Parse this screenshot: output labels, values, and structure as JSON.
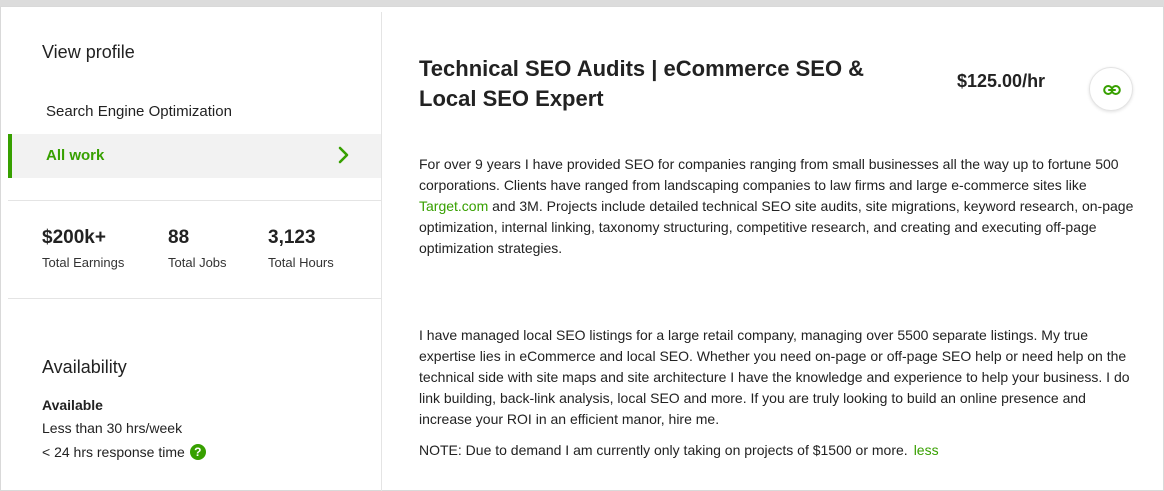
{
  "sidebar": {
    "view_profile": "View profile",
    "nav": {
      "category": "Search Engine Optimization",
      "all_work": "All work"
    },
    "stats": [
      {
        "value": "$200k+",
        "label": "Total Earnings"
      },
      {
        "value": "88",
        "label": "Total Jobs"
      },
      {
        "value": "3,123",
        "label": "Total Hours"
      }
    ],
    "availability": {
      "title": "Availability",
      "status": "Available",
      "hours": "Less than 30 hrs/week",
      "response": "< 24 hrs response time",
      "help_icon": "?"
    }
  },
  "main": {
    "title": "Technical SEO Audits | eCommerce SEO & Local SEO Expert",
    "rate": "$125.00/hr",
    "paragraph1_a": "For over 9 years I have provided SEO for companies ranging from small businesses all the way up to fortune 500 corporations. Clients have ranged from landscaping companies to law firms and large e-commerce sites like ",
    "paragraph1_link": "Target.com",
    "paragraph1_b": " and 3M. Projects include detailed technical SEO site audits, site migrations, keyword research, on-page optimization, internal linking, taxonomy structuring, competitive research, and creating and executing off-page optimization strategies.",
    "paragraph2": "I have managed local SEO listings for a large retail company, managing over 5500 separate listings. My true expertise lies in eCommerce and local SEO. Whether you need on-page or off-page SEO help or need help on the technical side with site maps and site architecture I have the knowledge and experience to help your business. I do link building, back-link analysis, local SEO and more. If you are truly looking to build an online presence and increase your ROI in an efficient manor, hire me.",
    "note": "NOTE: Due to demand I am currently only taking on projects of $1500 or more.",
    "less": "less"
  },
  "colors": {
    "accent_green": "#37a000",
    "text": "#222222",
    "selected_bg": "#f2f2f2"
  },
  "icons": {
    "chevron": "chevron-right-icon",
    "link": "link-icon",
    "help": "help-circle-icon"
  }
}
